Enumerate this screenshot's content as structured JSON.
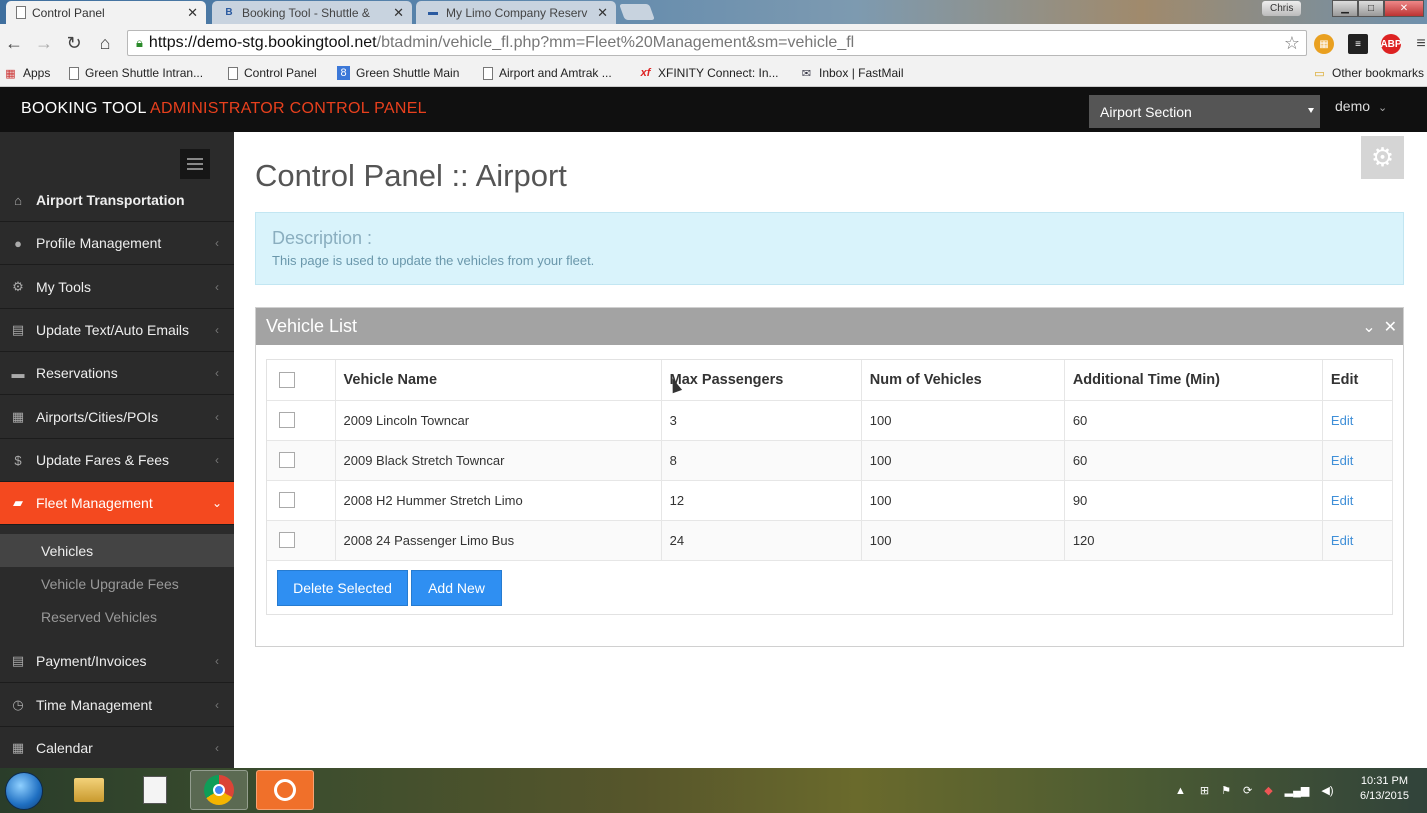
{
  "browser": {
    "tabs": [
      {
        "title": "Control Panel",
        "active": true
      },
      {
        "title": "Booking Tool - Shuttle &",
        "active": false
      },
      {
        "title": "My Limo Company Reserv",
        "active": false
      }
    ],
    "profile_name": "Chris",
    "url_scheme_host": "https://demo-stg.bookingtool.net",
    "url_path": "/btadmin/vehicle_fl.php?mm=Fleet%20Management&sm=vehicle_fl",
    "bookmarks": [
      {
        "label": "Apps",
        "icon": "apps-grid-icon"
      },
      {
        "label": "Green Shuttle Intran...",
        "icon": "page-icon"
      },
      {
        "label": "Control Panel",
        "icon": "page-icon"
      },
      {
        "label": "Green Shuttle Main",
        "icon": "google-sites-icon"
      },
      {
        "label": "Airport and Amtrak ...",
        "icon": "page-icon"
      },
      {
        "label": "XFINITY Connect: In...",
        "icon": "xfinity-icon"
      },
      {
        "label": "Inbox | FastMail",
        "icon": "mail-icon"
      },
      {
        "label": "Other bookmarks",
        "icon": "folder-icon"
      }
    ]
  },
  "header": {
    "brand_main": "BOOKING TOOL",
    "brand_accent": "ADMINISTRATOR CONTROL PANEL",
    "section_select": "Airport Section",
    "user": "demo"
  },
  "sidebar": {
    "items": [
      {
        "label": "Airport Transportation",
        "icon": "home-icon"
      },
      {
        "label": "Profile Management",
        "icon": "user-icon"
      },
      {
        "label": "My Tools",
        "icon": "cogs-icon"
      },
      {
        "label": "Update Text/Auto Emails",
        "icon": "file-icon"
      },
      {
        "label": "Reservations",
        "icon": "briefcase-icon"
      },
      {
        "label": "Airports/Cities/POIs",
        "icon": "grid-icon"
      },
      {
        "label": "Update Fares & Fees",
        "icon": "dollar-icon"
      },
      {
        "label": "Fleet Management",
        "icon": "truck-icon"
      },
      {
        "label": "Payment/Invoices",
        "icon": "file-icon"
      },
      {
        "label": "Time Management",
        "icon": "clock-icon"
      },
      {
        "label": "Calendar",
        "icon": "calendar-icon"
      }
    ],
    "sub_items": [
      {
        "label": "Vehicles"
      },
      {
        "label": "Vehicle Upgrade Fees"
      },
      {
        "label": "Reserved Vehicles"
      }
    ]
  },
  "main": {
    "title": "Control Panel :: Airport",
    "description_title": "Description :",
    "description_text": "This page is used to update the vehicles from your fleet.",
    "panel_title": "Vehicle List",
    "columns": [
      "Vehicle Name",
      "Max Passengers",
      "Num of Vehicles",
      "Additional Time (Min)",
      "Edit"
    ],
    "rows": [
      {
        "name": "2009 Lincoln Towncar",
        "max": "3",
        "num": "100",
        "time": "60",
        "edit": "Edit"
      },
      {
        "name": "2009 Black Stretch Towncar",
        "max": "8",
        "num": "100",
        "time": "60",
        "edit": "Edit"
      },
      {
        "name": "2008 H2 Hummer Stretch Limo",
        "max": "12",
        "num": "100",
        "time": "90",
        "edit": "Edit"
      },
      {
        "name": "2008 24 Passenger Limo Bus",
        "max": "24",
        "num": "100",
        "time": "120",
        "edit": "Edit"
      }
    ],
    "buttons": {
      "delete": "Delete Selected",
      "add": "Add New"
    }
  },
  "taskbar": {
    "time": "10:31 PM",
    "date": "6/13/2015"
  },
  "colors": {
    "accent": "#f4491f",
    "brand_accent": "#e8401d",
    "button": "#2f8ff2",
    "description_bg": "#d9f3fb"
  }
}
